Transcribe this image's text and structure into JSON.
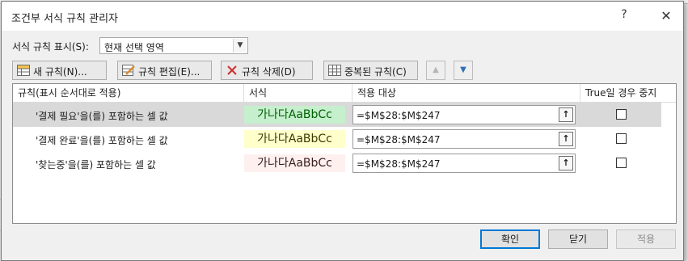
{
  "dialog": {
    "title": "조건부 서식 규칙 관리자",
    "help": "?",
    "close": "✕"
  },
  "show_rules": {
    "label": "서식 규칙 표시(S):",
    "value": "현재 선택 영역"
  },
  "toolbar": {
    "new_rule": "새 규칙(N)...",
    "edit_rule": "규칙 편집(E)...",
    "delete_rule": "규칙 삭제(D)",
    "duplicate_rule": "중복된 규칙(C)",
    "move_up": "▲",
    "move_down": "▼"
  },
  "columns": {
    "rule": "규칙(표시 순서대로 적용)",
    "format": "서식",
    "applies_to": "적용 대상",
    "stop_if_true": "True일 경우 중지"
  },
  "rules": [
    {
      "name": "'결제 필요'을(를) 포함하는 셀 값",
      "preview": "가나다AaBbCc",
      "applies_to": "=$M$28:$M$247",
      "stop_if_true": false,
      "preview_bg": "#c6efce",
      "preview_fg": "#006100",
      "selected": true
    },
    {
      "name": "'결제 완료'을(를) 포함하는 셀 값",
      "preview": "가나다AaBbCc",
      "applies_to": "=$M$28:$M$247",
      "stop_if_true": false,
      "preview_bg": "#ffffcc",
      "preview_fg": "#3b3b00",
      "selected": false
    },
    {
      "name": "'찾는중'을(를) 포함하는 셀 값",
      "preview": "가나다AaBbCc",
      "applies_to": "=$M$28:$M$247",
      "stop_if_true": false,
      "preview_bg": "#fdf0ee",
      "preview_fg": "#3a2020",
      "selected": false
    }
  ],
  "footer": {
    "ok": "확인",
    "close": "닫기",
    "apply": "적용"
  },
  "colors": {
    "accent": "#0078d7",
    "selected_row": "#d9d9d9"
  }
}
